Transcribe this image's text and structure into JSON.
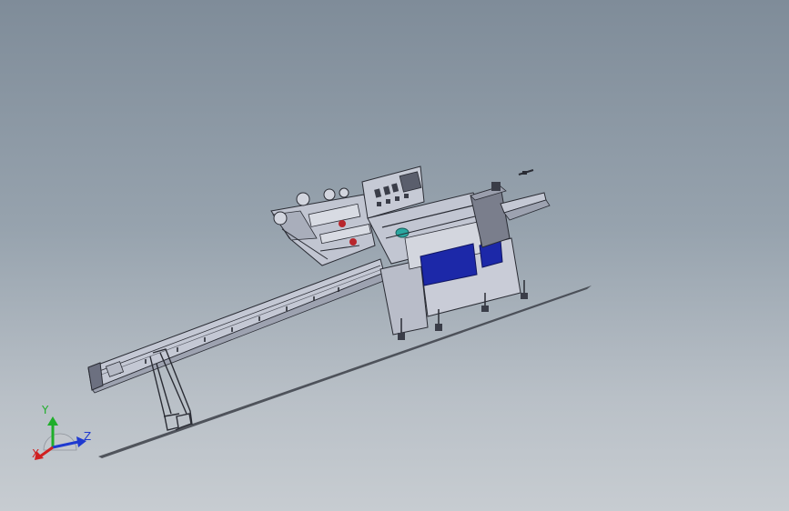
{
  "viewport": {
    "background_top": "#7f8c99",
    "background_bottom": "#c7ccd1",
    "model": "flow-wrap-packaging-machine"
  },
  "machine_colors": {
    "frame": "#c7cbd6",
    "frame_shade": "#a9aebb",
    "edge": "#2a2c34",
    "panel_dark": "#6c7080",
    "guard_blue": "#1c28a8",
    "accent_teal": "#2aa7a0",
    "accent_red": "#b8262c"
  },
  "triad": {
    "x_label": "X",
    "y_label": "Y",
    "z_label": "Z",
    "x_color": "#d02020",
    "y_color": "#1fae2a",
    "z_color": "#1f3ad0"
  }
}
